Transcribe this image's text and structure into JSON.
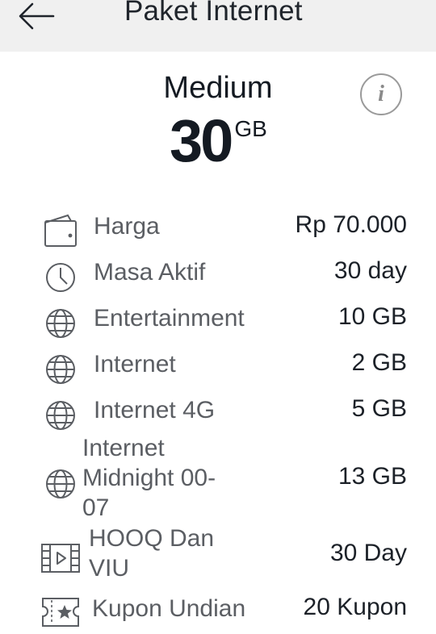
{
  "header": {
    "title": "Paket Internet",
    "back_icon": "arrow-left-icon"
  },
  "plan": {
    "name": "Medium",
    "size": "30",
    "unit": "GB",
    "info_icon": "i"
  },
  "details": [
    {
      "icon": "wallet-icon",
      "label": "Harga",
      "value": "Rp 70.000"
    },
    {
      "icon": "clock-icon",
      "label": "Masa Aktif",
      "value": "30 day"
    },
    {
      "icon": "globe-icon",
      "label": "Entertainment",
      "value": "10 GB"
    },
    {
      "icon": "globe-icon",
      "label": "Internet",
      "value": "2 GB"
    },
    {
      "icon": "globe-icon",
      "label": "Internet 4G",
      "value": "5 GB"
    },
    {
      "icon": "globe-icon",
      "label_lines": [
        "Internet",
        "Midnight 00-",
        "07"
      ],
      "value": "13 GB"
    },
    {
      "icon": "film-icon",
      "label_lines": [
        "HOOQ Dan",
        "VIU"
      ],
      "value": "30 Day"
    },
    {
      "icon": "ticket-icon",
      "label": "Kupon Undian",
      "value": "20 Kupon"
    }
  ]
}
